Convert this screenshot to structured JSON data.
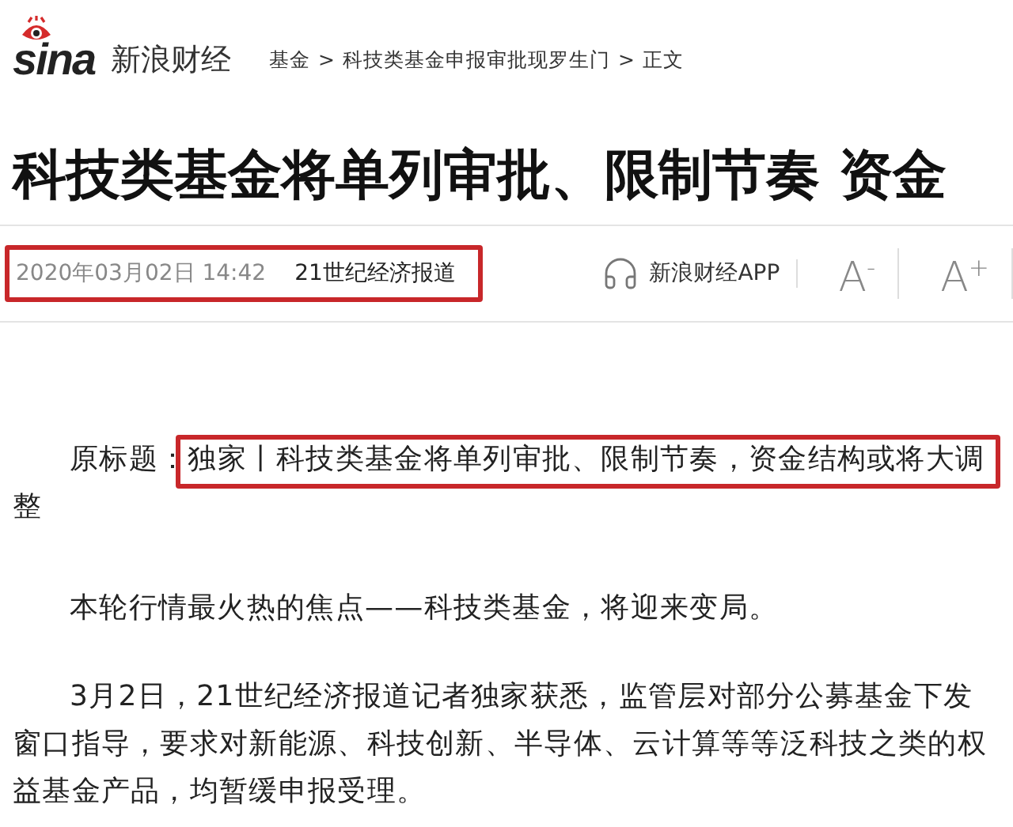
{
  "header": {
    "logo_text": "sina",
    "site_name": "新浪财经",
    "breadcrumb": [
      "基金",
      "科技类基金申报审批现罗生门",
      "正文"
    ],
    "separator": ">"
  },
  "headline": "科技类基金将单列审批、限制节奏 资金",
  "meta": {
    "date": "2020年03月02日 14:42",
    "source": "21世纪经济报道",
    "highlighted": true,
    "app_link": "新浪财经APP",
    "font_buttons": [
      "A$^{-}$",
      "A$^{+}$"
    ]
  },
  "article": {
    "original_title_label": "原标题：",
    "original_title": "独家丨科技类基金将单列审批、限制节奏，资金结构或将大调整",
    "original_title_highlighted": true,
    "paragraphs": [
      "本轮行情最火热的焦点——科技类基金，将迎来变局。",
      "3月2日，21世纪经济报道记者独家获悉，监管层对部分公募基金下发窗口指导，要求对新能源、科技创新、半导体、云计算等等泛科技之类的权益基金产品，均暂缓申报受理。"
    ]
  }
}
